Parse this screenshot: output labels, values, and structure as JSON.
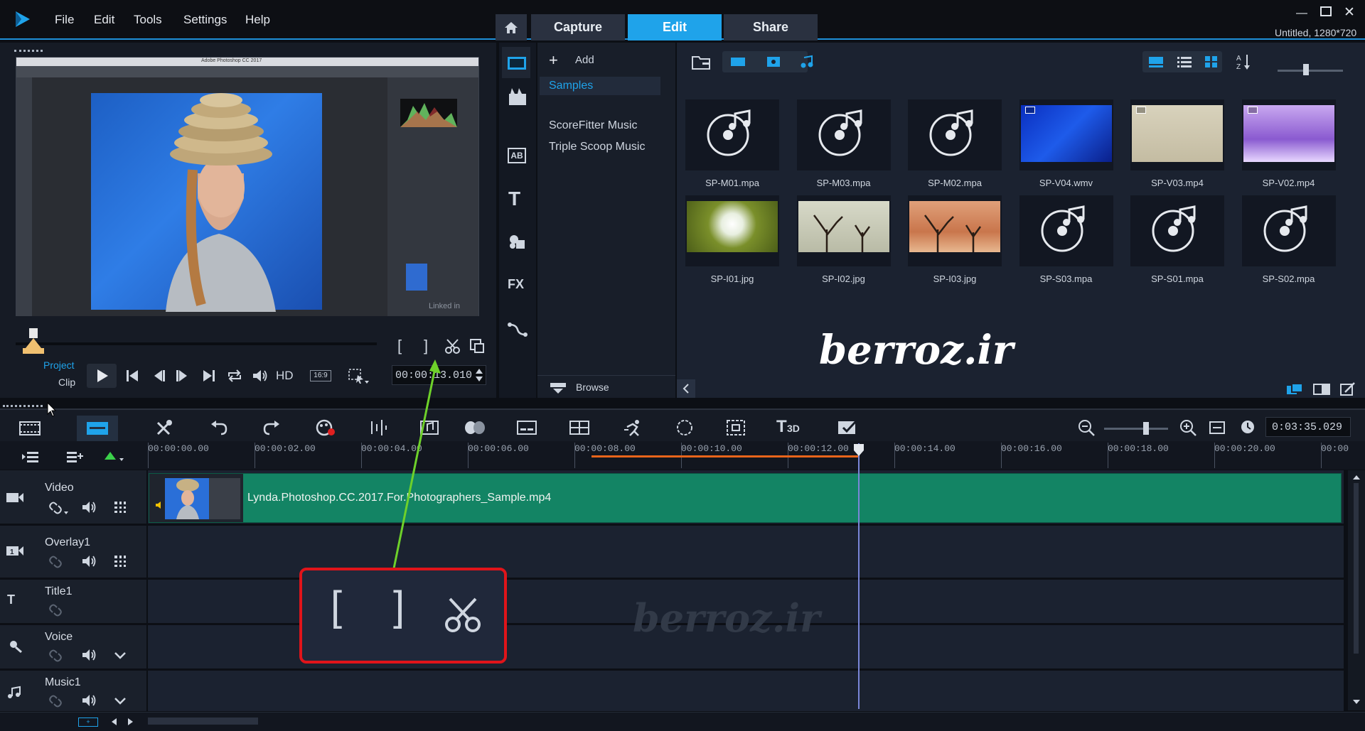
{
  "app": {
    "title_info": "Untitled, 1280*720"
  },
  "menu": [
    "File",
    "Edit",
    "Tools",
    "Settings",
    "Help"
  ],
  "tabs": {
    "capture": "Capture",
    "edit": "Edit",
    "share": "Share"
  },
  "preview": {
    "project_label": "Project",
    "clip_label": "Clip",
    "hd_label": "HD",
    "aspect": "16:9",
    "timecode": "00:00:13.010",
    "screen_app_title": "Adobe Photoshop CC 2017",
    "screen_watermark": "Linked in"
  },
  "library": {
    "add_label": "Add",
    "folders": [
      "Samples",
      "ScoreFitter Music",
      "Triple Scoop Music"
    ],
    "browse_label": "Browse",
    "fx_label": "FX",
    "items": [
      {
        "name": "SP-M01.mpa",
        "kind": "audio"
      },
      {
        "name": "SP-M03.mpa",
        "kind": "audio"
      },
      {
        "name": "SP-M02.mpa",
        "kind": "audio"
      },
      {
        "name": "SP-V04.wmv",
        "kind": "video-blue"
      },
      {
        "name": "SP-V03.mp4",
        "kind": "video-beige"
      },
      {
        "name": "SP-V02.mp4",
        "kind": "video-purple"
      },
      {
        "name": "SP-I01.jpg",
        "kind": "image-dandelion"
      },
      {
        "name": "SP-I02.jpg",
        "kind": "image-trees"
      },
      {
        "name": "SP-I03.jpg",
        "kind": "image-desert"
      },
      {
        "name": "SP-S03.mpa",
        "kind": "audio"
      },
      {
        "name": "SP-S01.mpa",
        "kind": "audio"
      },
      {
        "name": "SP-S02.mpa",
        "kind": "audio"
      }
    ],
    "watermark": "berroz.ir"
  },
  "timeline": {
    "duration": "0:03:35.029",
    "ticks": [
      "00:00:00.00",
      "00:00:02.00",
      "00:00:04.00",
      "00:00:06.00",
      "00:00:08.00",
      "00:00:10.00",
      "00:00:12.00",
      "00:00:14.00",
      "00:00:16.00",
      "00:00:18.00",
      "00:00:20.00",
      "00:00"
    ],
    "tracks": [
      {
        "name": "Video"
      },
      {
        "name": "Overlay1"
      },
      {
        "name": "Title1"
      },
      {
        "name": "Voice"
      },
      {
        "name": "Music1"
      }
    ],
    "clip_name": "Lynda.Photoshop.CC.2017.For.Photographers_Sample.mp4",
    "watermark": "berroz.ir",
    "t3d_label": "3D",
    "add_track_label": "+"
  },
  "callout": {
    "open_bracket": "[",
    "close_bracket": "]"
  },
  "colors": {
    "accent": "#1fa3ea",
    "clip": "#138464",
    "callout_border": "#e0141a",
    "arrow": "#6ed12a",
    "orange": "#e8641a"
  }
}
